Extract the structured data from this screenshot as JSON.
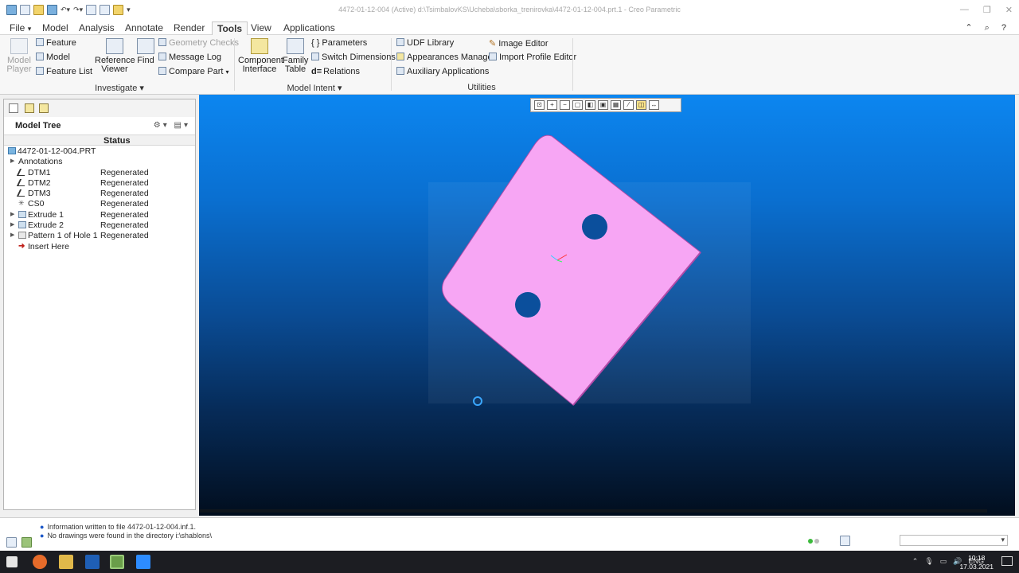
{
  "window": {
    "title": "4472-01-12-004 (Active) d:\\TsimbalovKS\\Ucheba\\sborka_trenirovka\\4472-01-12-004.prt.1 - Creo Parametric",
    "controls": [
      "—",
      "❐",
      "✕"
    ]
  },
  "menu": {
    "tabs": [
      "File",
      "Model",
      "Analysis",
      "Annotate",
      "Render",
      "Tools",
      "View",
      "Applications"
    ],
    "file_arrow": "▾",
    "active": "Tools",
    "right_icons": "⌃ ⌕ ?"
  },
  "ribbon": {
    "investigate": {
      "model_player": [
        "Model",
        "Player"
      ],
      "feature": "Feature",
      "model": "Model",
      "feature_list": "Feature List",
      "reference_viewer": [
        "Reference",
        "Viewer"
      ],
      "find": "Find",
      "geometry_checks": "Geometry Checks",
      "message_log": "Message Log",
      "compare_part": "Compare Part",
      "label": "Investigate ▾"
    },
    "model_intent": {
      "component_interface": [
        "Component",
        "Interface"
      ],
      "family_table": [
        "Family",
        "Table"
      ],
      "parameters": "Parameters",
      "switch_dimensions": "Switch Dimensions",
      "relations": "Relations",
      "label": "Model Intent ▾"
    },
    "utilities": {
      "udf_library": "UDF Library",
      "appearances_manager": "Appearances Manager",
      "auxiliary_applications": "Auxiliary Applications",
      "image_editor": "Image Editor",
      "import_profile_editor": "Import Profile Editor",
      "label": "Utilities"
    }
  },
  "model_tree": {
    "title": "Model Tree",
    "column_status": "Status",
    "items": [
      {
        "label": "4472-01-12-004.PRT",
        "status": "",
        "icon": "part-icon",
        "expander": ""
      },
      {
        "label": "Annotations",
        "status": "",
        "icon": "",
        "expander": "▶"
      },
      {
        "label": "DTM1",
        "status": "Regenerated",
        "icon": "datum-plane-icon",
        "expander": ""
      },
      {
        "label": "DTM2",
        "status": "Regenerated",
        "icon": "datum-plane-icon",
        "expander": ""
      },
      {
        "label": "DTM3",
        "status": "Regenerated",
        "icon": "datum-plane-icon",
        "expander": ""
      },
      {
        "label": "CS0",
        "status": "Regenerated",
        "icon": "csys-icon",
        "expander": ""
      },
      {
        "label": "Extrude 1",
        "status": "Regenerated",
        "icon": "extrude-icon",
        "expander": "▶"
      },
      {
        "label": "Extrude 2",
        "status": "Regenerated",
        "icon": "extrude-icon",
        "expander": "▶"
      },
      {
        "label": "Pattern 1 of Hole 1",
        "status": "Regenerated",
        "icon": "pattern-icon",
        "expander": "▶"
      },
      {
        "label": "Insert Here",
        "status": "",
        "icon": "insert-here-icon",
        "expander": ""
      }
    ]
  },
  "messages": [
    "Information written to file 4472-01-12-004.inf.1.",
    "No drawings were found in the directory i:\\shablons\\"
  ],
  "taskbar": {
    "language": "ENG",
    "time": "10:18",
    "date": "17.03.2021"
  },
  "colors": {
    "part_fill": "#f7a6f4",
    "part_edge": "#b24aa8",
    "viewport_top": "#0c86f0",
    "viewport_bottom": "#020e1e"
  }
}
